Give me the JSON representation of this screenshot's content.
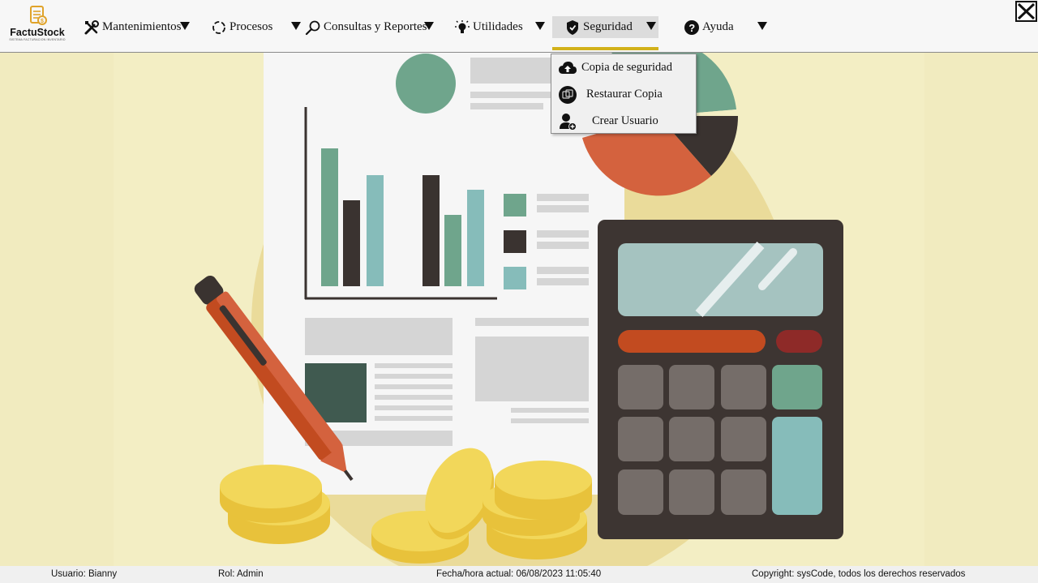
{
  "app": {
    "name": "FactuStock",
    "tagline": "SISTEMA FACTURACION INVENTARIO"
  },
  "menu": {
    "items": [
      {
        "key": "mantenimientos",
        "label": "Mantenimientos",
        "icon": "tools-icon"
      },
      {
        "key": "procesos",
        "label": "Procesos",
        "icon": "refresh-icon"
      },
      {
        "key": "consultas",
        "label": "Consultas y Reportes",
        "icon": "search-icon"
      },
      {
        "key": "utilidades",
        "label": "Utilidades",
        "icon": "lightbulb-icon"
      },
      {
        "key": "seguridad",
        "label": "Seguridad",
        "icon": "shield-icon",
        "active": true
      },
      {
        "key": "ayuda",
        "label": "Ayuda",
        "icon": "help-icon"
      }
    ]
  },
  "dropdown": {
    "items": [
      {
        "label": "Copia de seguridad",
        "icon": "cloud-upload-icon"
      },
      {
        "label": "Restaurar Copia",
        "icon": "restore-icon"
      },
      {
        "label": "Crear Usuario",
        "icon": "add-user-icon"
      }
    ]
  },
  "status": {
    "user": "Usuario: Bianny",
    "role": "Rol: Admin",
    "datetime": "Fecha/hora actual: 06/08/2023 11:05:40",
    "copyright": "Copyright: sysCode, todos los derechos reservados"
  },
  "colors": {
    "accent": "#d2b11a",
    "background": "#f3eec4",
    "green": "#6fa58c",
    "teal": "#86bcba",
    "orange": "#d4623e",
    "dark": "#3a3330"
  }
}
